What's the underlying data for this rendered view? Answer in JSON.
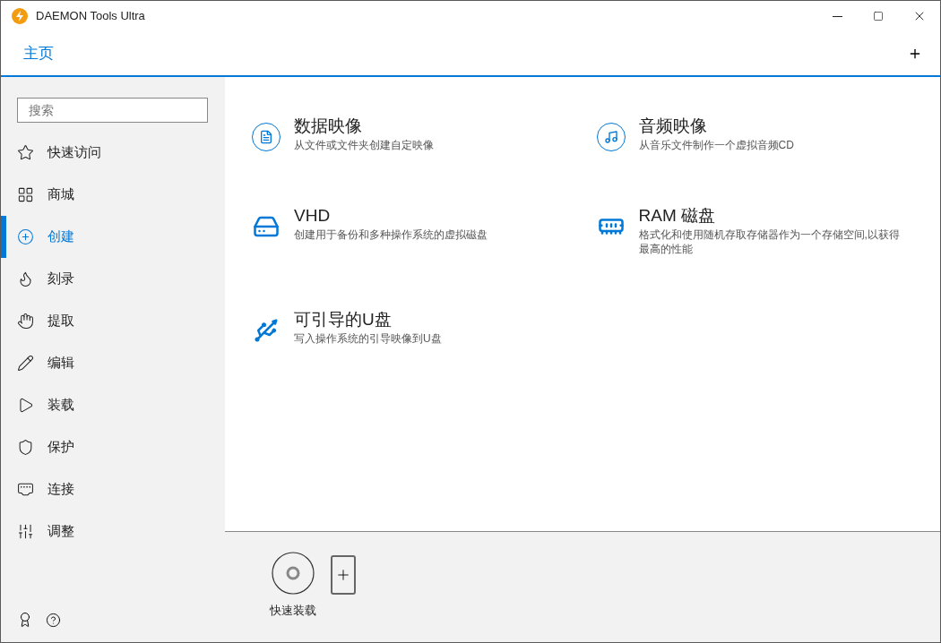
{
  "window": {
    "title": "DAEMON Tools Ultra"
  },
  "header": {
    "title": "主页"
  },
  "sidebar": {
    "search": {
      "placeholder": "搜索"
    },
    "items": [
      {
        "kind": "star",
        "label": "快速访问",
        "selected": false
      },
      {
        "kind": "grid",
        "label": "商城",
        "selected": false
      },
      {
        "kind": "create",
        "label": "创建",
        "selected": true
      },
      {
        "kind": "flame",
        "label": "刻录",
        "selected": false
      },
      {
        "kind": "hand",
        "label": "提取",
        "selected": false
      },
      {
        "kind": "pencil",
        "label": "编辑",
        "selected": false
      },
      {
        "kind": "play",
        "label": "装载",
        "selected": false
      },
      {
        "kind": "shield",
        "label": "保护",
        "selected": false
      },
      {
        "kind": "network",
        "label": "连接",
        "selected": false
      },
      {
        "kind": "sliders",
        "label": "调整",
        "selected": false
      }
    ]
  },
  "tiles": [
    {
      "kind": "data",
      "title": "数据映像",
      "description": "从文件或文件夹创建自定映像"
    },
    {
      "kind": "audio",
      "title": "音频映像",
      "description": "从音乐文件制作一个虚拟音频CD"
    },
    {
      "kind": "vhd",
      "title": "VHD",
      "description": "创建用于备份和多种操作系统的虚拟磁盘"
    },
    {
      "kind": "ram",
      "title": "RAM 磁盘",
      "description": "格式化和使用随机存取存储器作为一个存储空间,以获得最高的性能"
    },
    {
      "kind": "usb",
      "title": "可引导的U盘",
      "description": "写入操作系统的引导映像到U盘"
    }
  ],
  "quick_mount": {
    "label": "快速装载"
  }
}
